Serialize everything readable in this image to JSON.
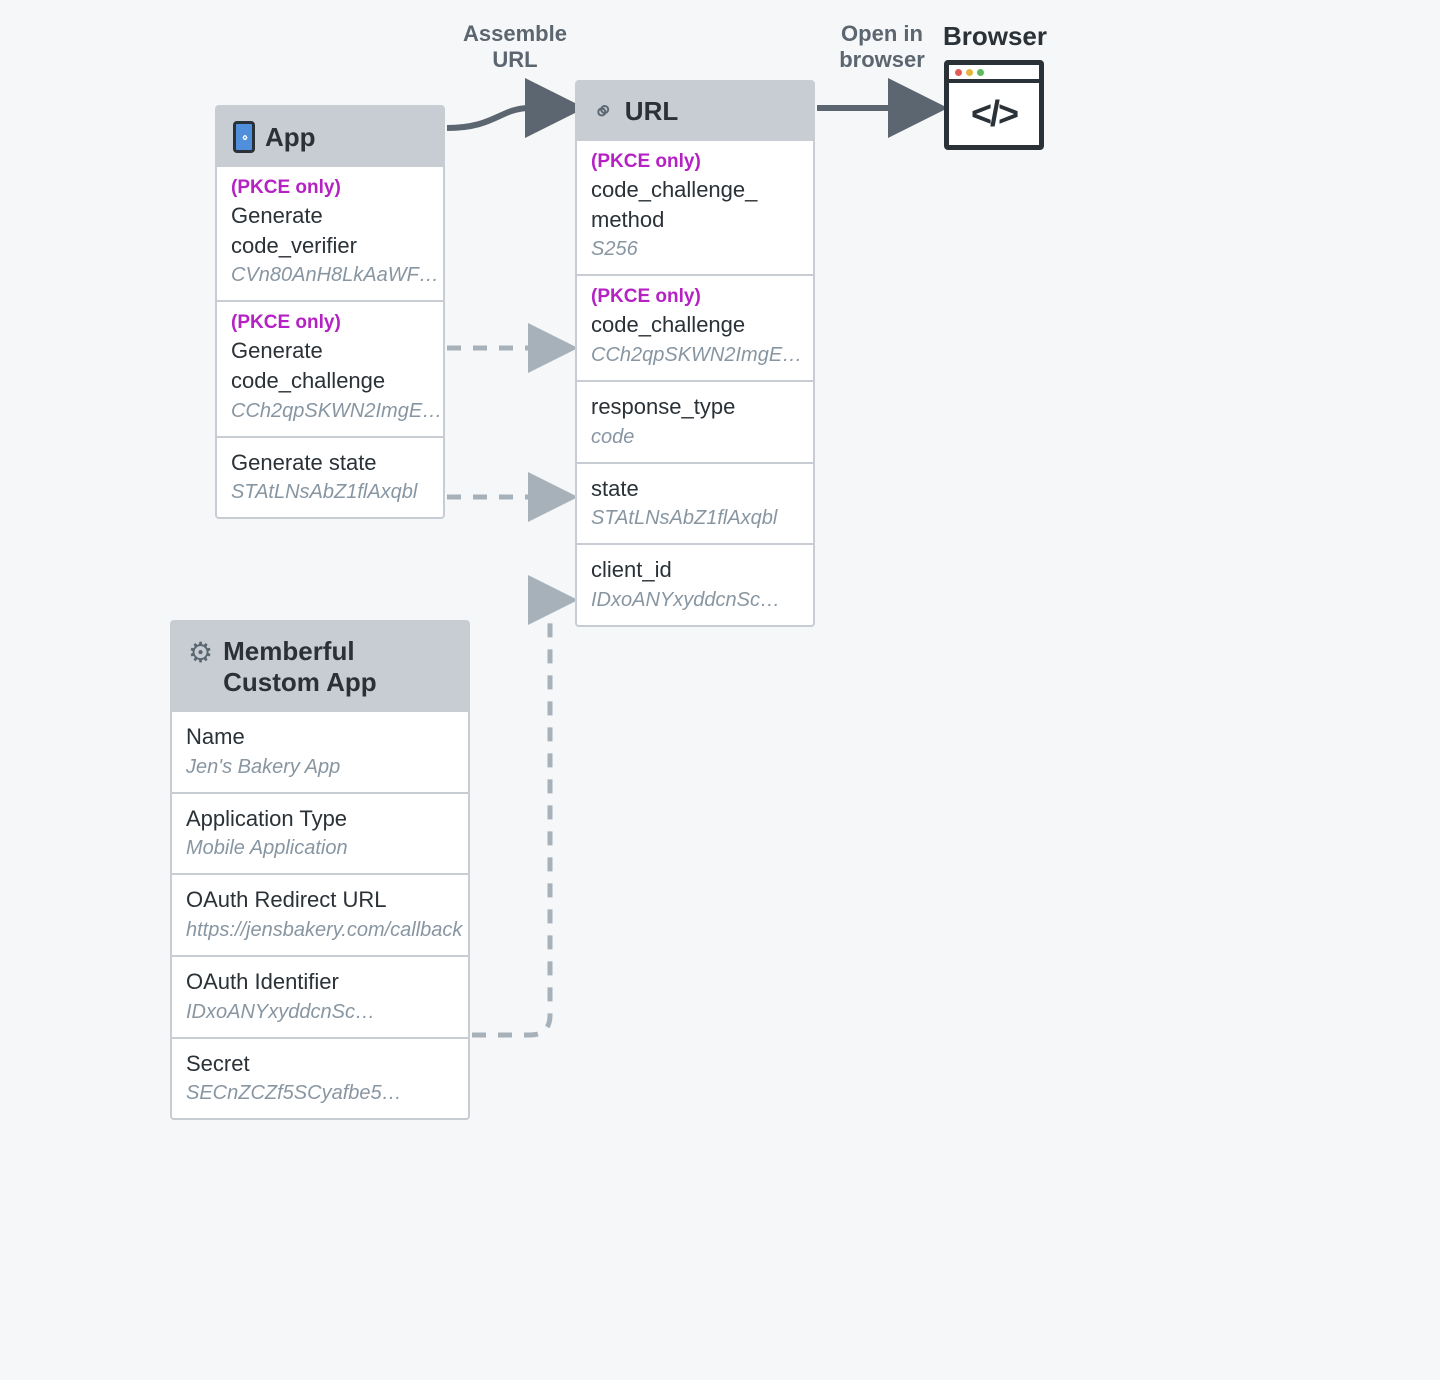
{
  "arrow_labels": {
    "assemble_url": "Assemble\nURL",
    "open_in_browser": "Open in\nbrowser",
    "browser_title": "Browser"
  },
  "app_box": {
    "title": "App",
    "rows": [
      {
        "tag": "(PKCE only)",
        "label": "Generate code_verifier",
        "value": "CVn80AnH8LkAaWF…"
      },
      {
        "tag": "(PKCE only)",
        "label": "Generate code_challenge",
        "value": "CCh2qpSKWN2ImgE…"
      },
      {
        "tag": "",
        "label": "Generate state",
        "value": "STAtLNsAbZ1flAxqbl"
      }
    ]
  },
  "url_box": {
    "title": "URL",
    "rows": [
      {
        "tag": "(PKCE only)",
        "label": "code_challenge_\nmethod",
        "value": "S256"
      },
      {
        "tag": "(PKCE only)",
        "label": "code_challenge",
        "value": "CCh2qpSKWN2ImgE…"
      },
      {
        "tag": "",
        "label": "response_type",
        "value": "code"
      },
      {
        "tag": "",
        "label": "state",
        "value": "STAtLNsAbZ1flAxqbl"
      },
      {
        "tag": "",
        "label": "client_id",
        "value": "IDxoANYxyddcnSc…"
      }
    ]
  },
  "memberful_box": {
    "title": "Memberful\nCustom App",
    "rows": [
      {
        "tag": "",
        "label": "Name",
        "value": "Jen's Bakery App"
      },
      {
        "tag": "",
        "label": "Application Type",
        "value": "Mobile Application"
      },
      {
        "tag": "",
        "label": "OAuth Redirect URL",
        "value": "https://jensbakery.com/callback"
      },
      {
        "tag": "",
        "label": "OAuth Identifier",
        "value": "IDxoANYxyddcnSc…"
      },
      {
        "tag": "",
        "label": "Secret",
        "value": "SECnZCZf5SCyafbe5…"
      }
    ]
  }
}
